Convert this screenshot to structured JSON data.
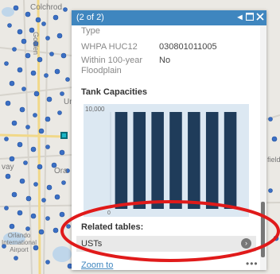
{
  "map": {
    "labels": {
      "top_left": "Colchrod",
      "vertical": "Golden",
      "mid_left": "Uni",
      "bottom_left_way": "vay",
      "ora": "Ora",
      "right": "field",
      "airport": "Orlando International Airport"
    }
  },
  "popup": {
    "title": "(2 of 2)",
    "icons": [
      "prev-icon",
      "maximize-icon",
      "close-icon"
    ],
    "fields": [
      {
        "label": "Type",
        "value": ""
      },
      {
        "label": "WHPA HUC12",
        "value": "030801011005"
      },
      {
        "label": "Within 100-year Floodplain",
        "value": "No"
      }
    ],
    "chart_section_title": "Tank Capacities",
    "related_tables_title": "Related tables:",
    "related_table_item": "USTs",
    "zoom_link": "Zoom to",
    "more_icon": "•••"
  },
  "chart_data": {
    "type": "bar",
    "title": "Tank Capacities",
    "categories": [
      "",
      "",
      "",
      "",
      "",
      "",
      ""
    ],
    "values": [
      10000,
      10000,
      10000,
      10000,
      10000,
      10000,
      10000
    ],
    "ytick_labels": [
      "10,000",
      "0"
    ],
    "ylim": [
      0,
      10000
    ],
    "colors": {
      "bar": "#1f3c5a",
      "background": "#dce8f2"
    }
  },
  "colors": {
    "header": "#3f86bf",
    "highlight_ellipse": "#e01a1a",
    "map_dot": "#3b6fc4"
  }
}
